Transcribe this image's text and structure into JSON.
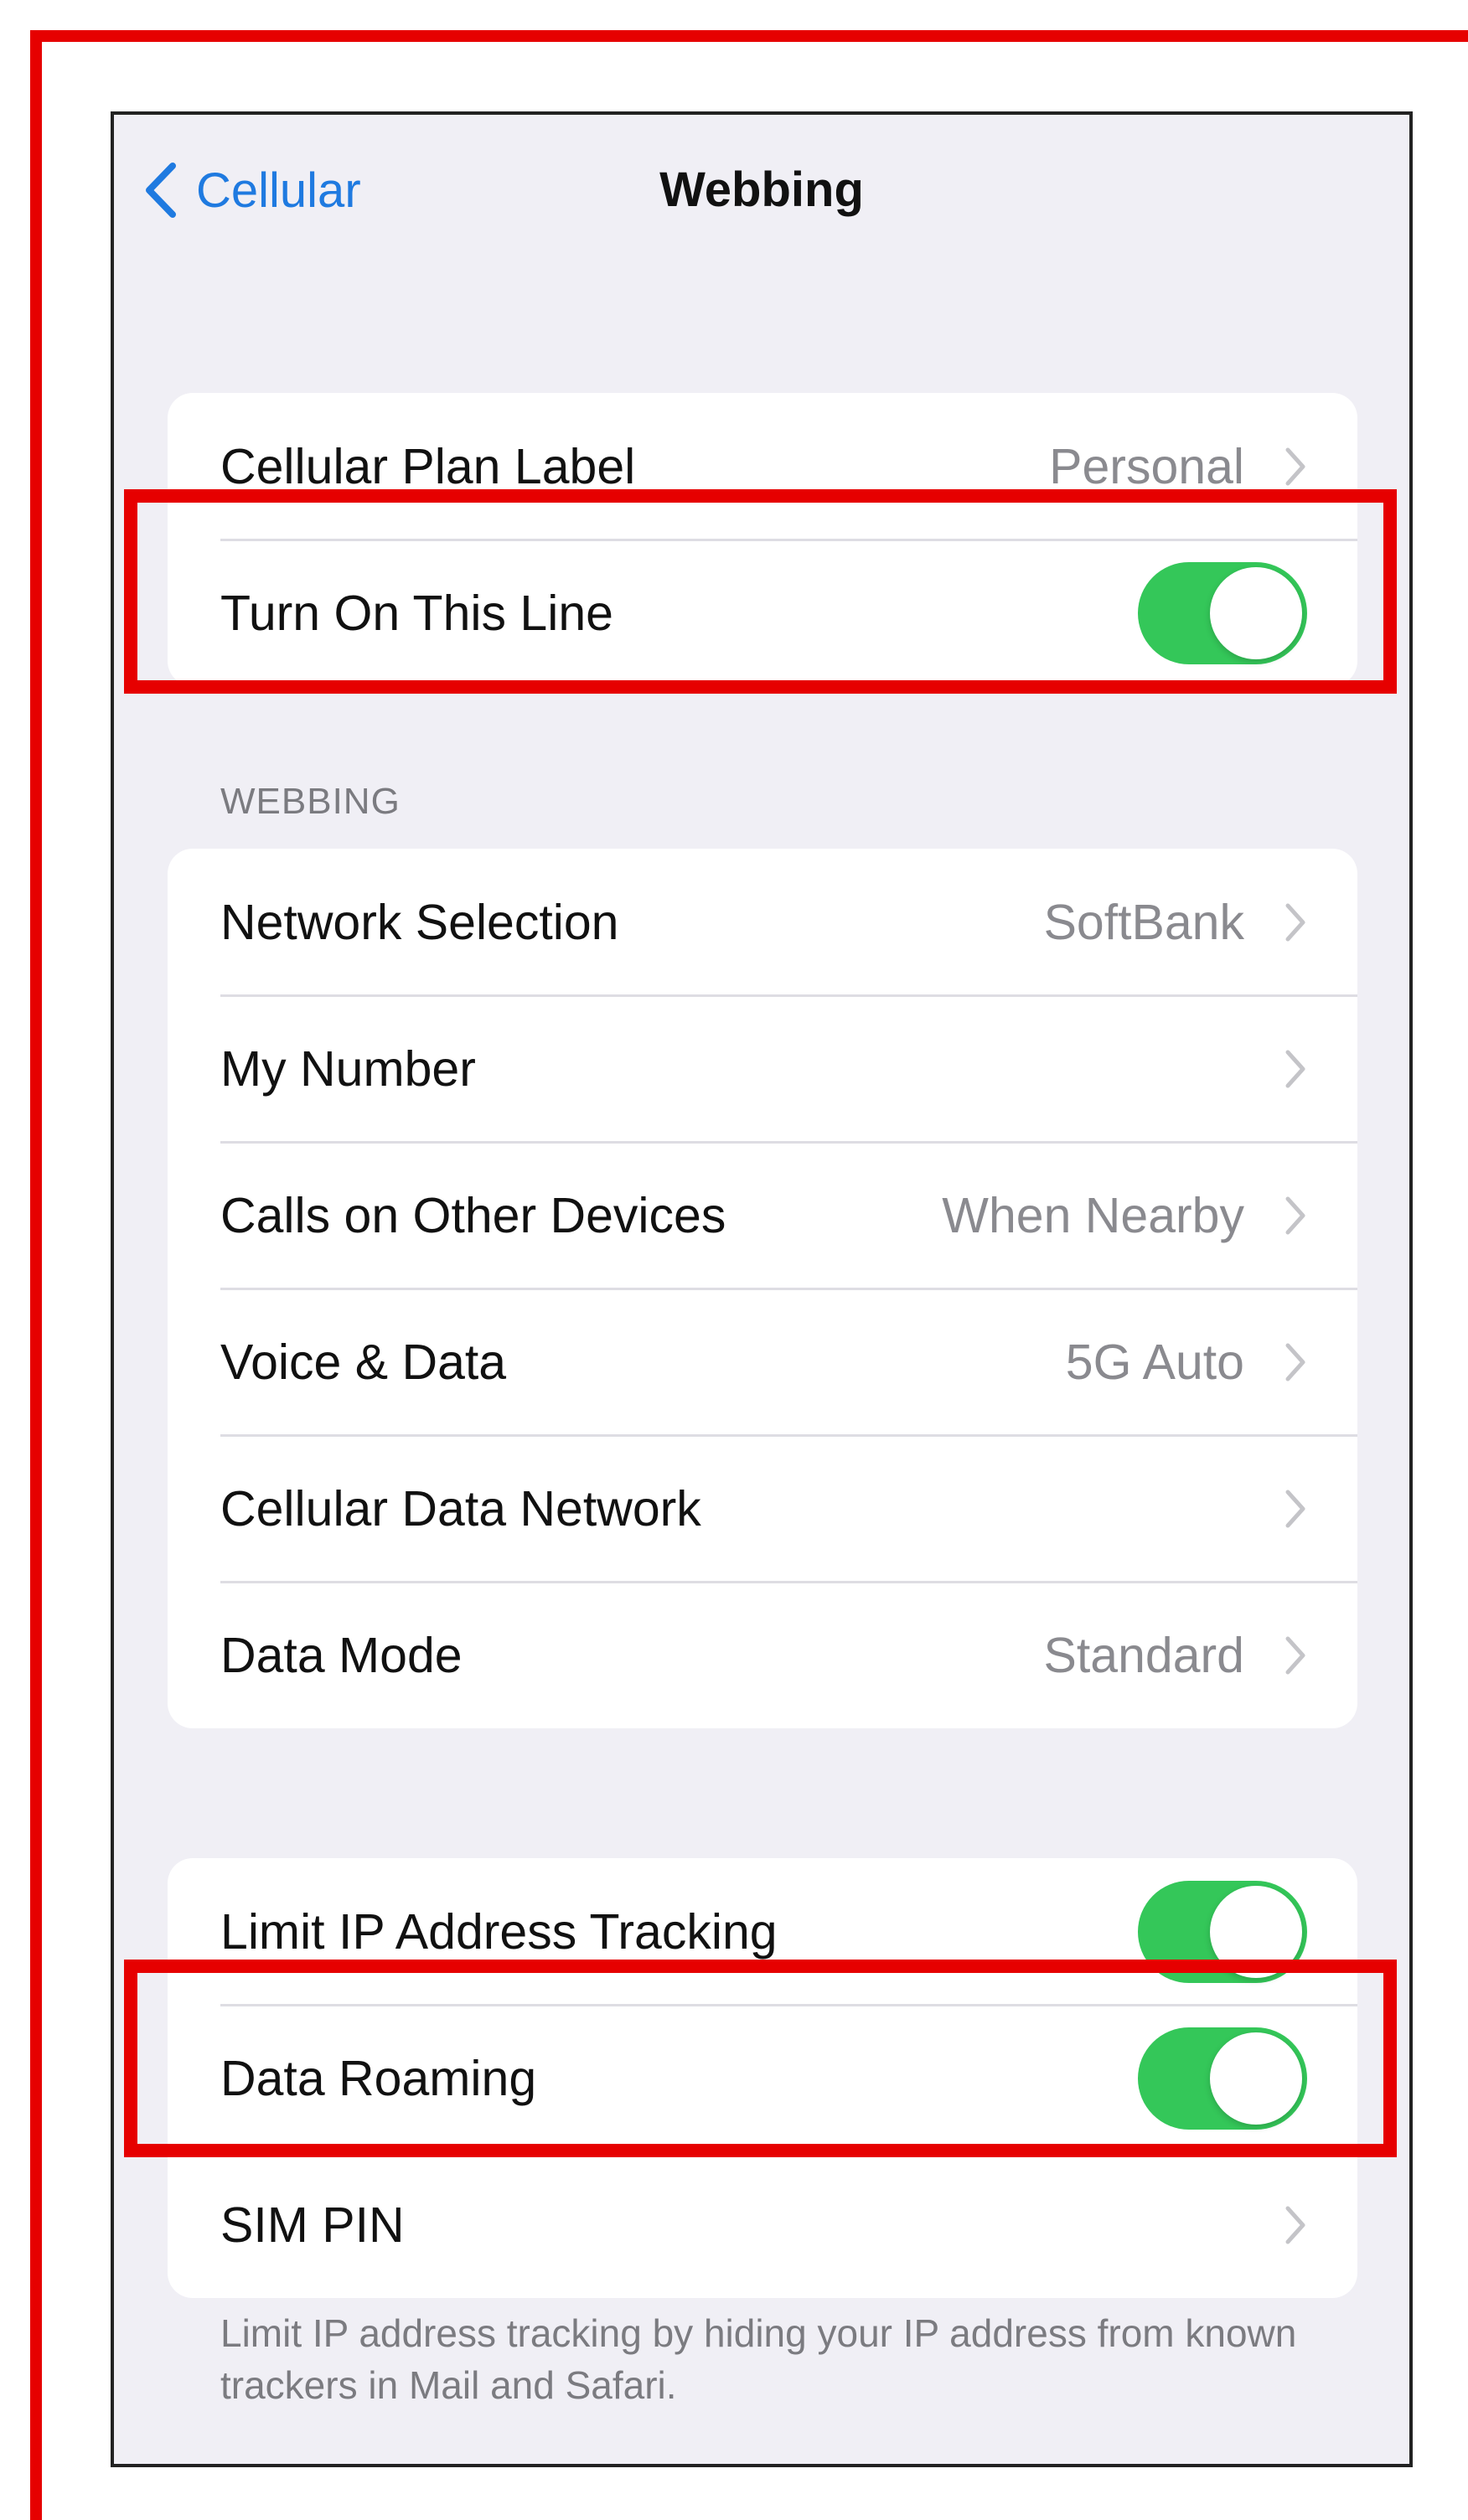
{
  "nav": {
    "back_label": "Cellular",
    "title": "Webbing",
    "back_icon": "chevron-left-icon"
  },
  "group1": {
    "rows": [
      {
        "label": "Cellular Plan Label",
        "value": "Personal"
      },
      {
        "label": "Turn On This Line",
        "toggle": true
      }
    ]
  },
  "section_header": "WEBBING",
  "group2": {
    "rows": [
      {
        "label": "Network Selection",
        "value": "SoftBank"
      },
      {
        "label": "My Number",
        "value": ""
      },
      {
        "label": "Calls on Other Devices",
        "value": "When Nearby"
      },
      {
        "label": "Voice & Data",
        "value": "5G Auto"
      },
      {
        "label": "Cellular Data Network",
        "value": ""
      },
      {
        "label": "Data Mode",
        "value": "Standard"
      }
    ]
  },
  "group3": {
    "rows": [
      {
        "label": "Limit IP Address Tracking",
        "toggle": true
      },
      {
        "label": "Data Roaming",
        "toggle": true
      },
      {
        "label": "SIM PIN",
        "value": ""
      }
    ]
  },
  "footer_text": "Limit IP address tracking by hiding your IP address from known trackers in Mail and Safari.",
  "colors": {
    "accent": "#1f7ae0",
    "toggle_on": "#34c759",
    "highlight": "#e60000"
  }
}
